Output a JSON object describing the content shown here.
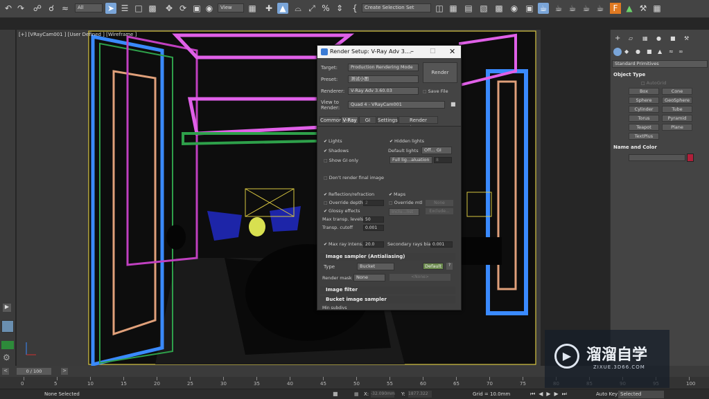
{
  "toolbar": {
    "filter_select": "All",
    "view_select": "View",
    "selection_set": "Create Selection Set"
  },
  "viewport": {
    "label": "[+] [VRayCam001 ] [User Defined ] [Wireframe ]"
  },
  "command_panel": {
    "category": "Standard Primitives",
    "object_type_title": "Object Type",
    "autogrid": "AutoGrid",
    "buttons": [
      "Box",
      "Cone",
      "Sphere",
      "GeoSphere",
      "Cylinder",
      "Tube",
      "Torus",
      "Pyramid",
      "Teapot",
      "Plane",
      "TextPlus"
    ],
    "name_color_title": "Name and Color",
    "swatch_color": "#b0203a"
  },
  "render_dialog": {
    "title": "Render Setup: V-Ray Adv 3....",
    "target_label": "Target:",
    "target_value": "Production Rendering Mode",
    "preset_label": "Preset:",
    "preset_value": "测试小图",
    "renderer_label": "Renderer:",
    "renderer_value": "V-Ray Adv 3.60.03",
    "save_file": "Save File",
    "view_label": "View to Render:",
    "view_value": "Quad 4 - VRayCam001",
    "render_button": "Render",
    "tabs": [
      "Common",
      "V-Ray",
      "GI",
      "Settings",
      "Render Elements"
    ],
    "global_switches": {
      "lights": "Lights",
      "hidden_lights": "Hidden lights",
      "shadows": "Shadows",
      "default_lights_label": "Default lights",
      "default_lights_value": "Off... GI",
      "show_gi_only": "Show GI only",
      "full_lighting": "Full lig...aluation",
      "dont_render": "Don't render final image",
      "reflection": "Reflection/refraction",
      "maps": "Maps",
      "override_depth": "Override depth",
      "override_depth_value": "2",
      "override_mtl": "Override mtl",
      "override_mtl_value": "None",
      "glossy": "Glossy effects",
      "include_list": "Inclu...list",
      "exclude": "Exclude...",
      "max_transp_label": "Max transp. levels",
      "max_transp_value": "50",
      "transp_cutoff_label": "Transp. cutoff",
      "transp_cutoff_value": "0.001",
      "max_ray_label": "Max ray intens.",
      "max_ray_value": "20.0",
      "secondary_bias_label": "Secondary rays bias",
      "secondary_bias_value": "0.001"
    },
    "image_sampler": {
      "title": "Image sampler (Antialiasing)",
      "type_label": "Type",
      "type_value": "Bucket",
      "default_button": "Default",
      "mask_label": "Render mask",
      "mask_value": "None",
      "mask_none": "<None>"
    },
    "image_filter_title": "Image filter",
    "bucket_title": "Bucket image sampler",
    "min_subdivs": "Min subdivs"
  },
  "timeline": {
    "frame": "0 / 100",
    "ticks": [
      "0",
      "5",
      "10",
      "15",
      "20",
      "25",
      "30",
      "35",
      "40",
      "45",
      "50",
      "55",
      "60",
      "65",
      "70",
      "75",
      "80",
      "85",
      "90",
      "95",
      "100"
    ]
  },
  "status": {
    "selection": "None Selected",
    "x_label": "X:",
    "x_value": "-32.090mm",
    "y_label": "Y:",
    "y_value": "1877.322",
    "grid": "Grid = 10.0mm",
    "auto_key": "Auto Key",
    "selected": "Selected"
  },
  "watermark": {
    "cn": "溜溜自学",
    "en": "ZIXUE.3D66.COM"
  }
}
